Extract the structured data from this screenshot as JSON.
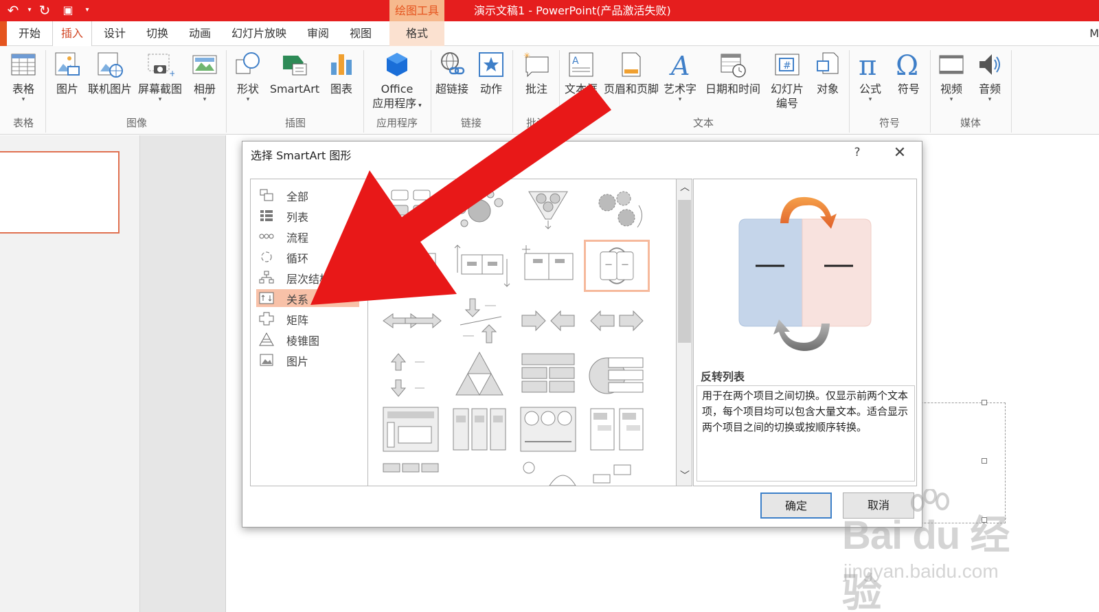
{
  "window": {
    "title": "演示文稿1 -  PowerPoint(产品激活失败)",
    "contextual_tab": "绘图工具",
    "quick_access": [
      "undo-icon",
      "redo-icon",
      "slideshow-icon",
      "customize-icon"
    ]
  },
  "tabs": [
    "开始",
    "插入",
    "设计",
    "切换",
    "动画",
    "幻灯片放映",
    "审阅",
    "视图",
    "格式"
  ],
  "tabs_extra": "M",
  "ribbon": {
    "buttons": {
      "table": "表格",
      "picture": "图片",
      "online_picture": "联机图片",
      "screenshot": "屏幕截图",
      "album": "相册",
      "shapes": "形状",
      "smartart": "SmartArt",
      "chart": "图表",
      "office_apps_1": "Office",
      "office_apps_2": "应用程序",
      "hyperlink": "超链接",
      "action": "动作",
      "comment": "批注",
      "textbox": "文本框",
      "header_footer": "页眉和页脚",
      "wordart": "艺术字",
      "datetime": "日期和时间",
      "slide_number_1": "幻灯片",
      "slide_number_2": "编号",
      "object": "对象",
      "equation": "公式",
      "symbol": "符号",
      "video": "视频",
      "audio": "音频"
    },
    "groups": {
      "tables": "表格",
      "images": "图像",
      "illustrations": "插图",
      "apps": "应用程序",
      "links": "链接",
      "comments": "批注",
      "text": "文本",
      "symbols": "符号",
      "media": "媒体"
    }
  },
  "dialog": {
    "title": "选择 SmartArt 图形",
    "help": "?",
    "close": "✕",
    "categories": [
      "全部",
      "列表",
      "流程",
      "循环",
      "层次结构",
      "关系",
      "矩阵",
      "棱锥图",
      "图片"
    ],
    "selected_category": "关系",
    "preview_name": "反转列表",
    "preview_description": "用于在两个项目之间切换。仅显示前两个文本项，每个项目均可以包含大量文本。适合显示两个项目之间的切换或按顺序转换。",
    "ok": "确定",
    "cancel": "取消"
  },
  "watermark": {
    "main": "Bai du 经验",
    "sub": "jingyan.baidu.com"
  },
  "colors": {
    "title_bar": "#e51e1e",
    "accent": "#d24726",
    "selection": "#f8c1a8",
    "arrow": "#e81818"
  }
}
